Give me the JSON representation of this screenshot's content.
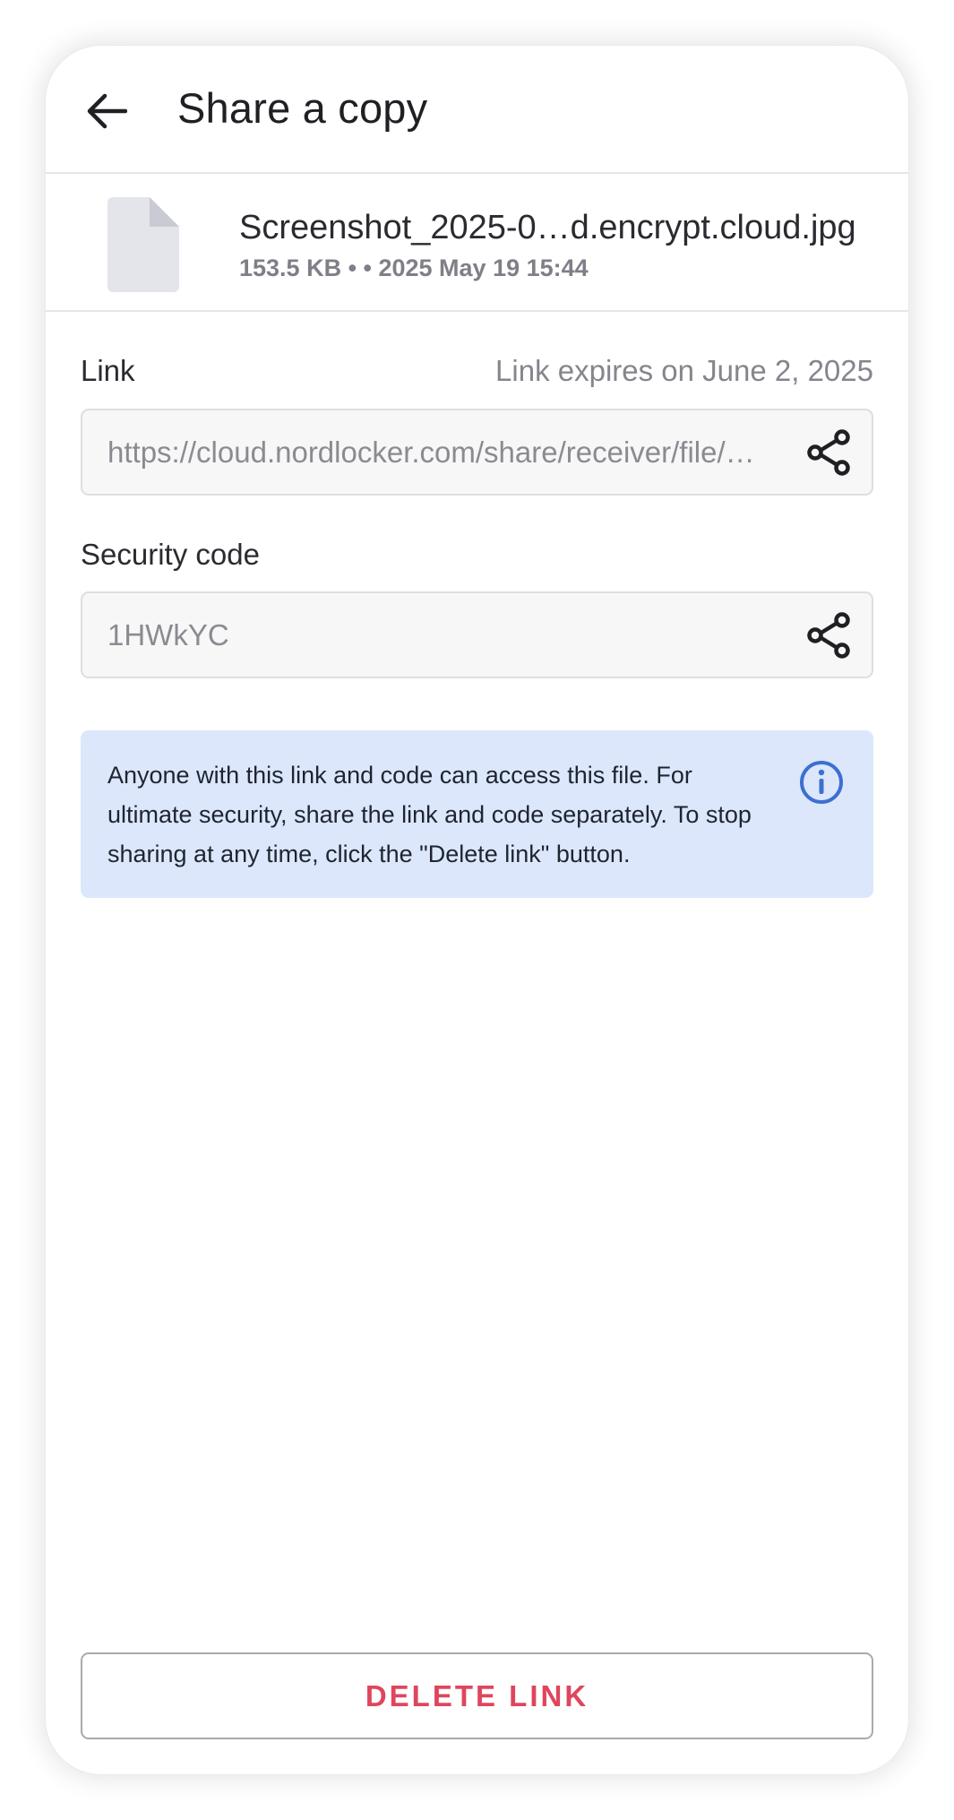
{
  "header": {
    "title": "Share a copy",
    "back_icon": "arrow-left-icon"
  },
  "file": {
    "name": "Screenshot_2025-0…d.encrypt.cloud.jpg",
    "meta": "153.5 KB •  • 2025 May 19 15:44",
    "icon": "file-icon"
  },
  "link": {
    "label": "Link",
    "expires": "Link expires on June 2, 2025",
    "value": "https://cloud.nordlocker.com/share/receiver/file/…",
    "share_icon": "share-icon"
  },
  "security": {
    "label": "Security code",
    "value": "1HWkYC",
    "share_icon": "share-icon"
  },
  "notice": {
    "text": "Anyone with this link and code can access this file. For ultimate security, share the link and code separately. To stop sharing at any time, click the \"Delete link\" button.",
    "icon": "info-icon"
  },
  "actions": {
    "delete_label": "DELETE LINK"
  },
  "colors": {
    "accent_red": "#e0455e",
    "info_bg": "#dce7fc",
    "info_icon": "#3d6fd0"
  }
}
